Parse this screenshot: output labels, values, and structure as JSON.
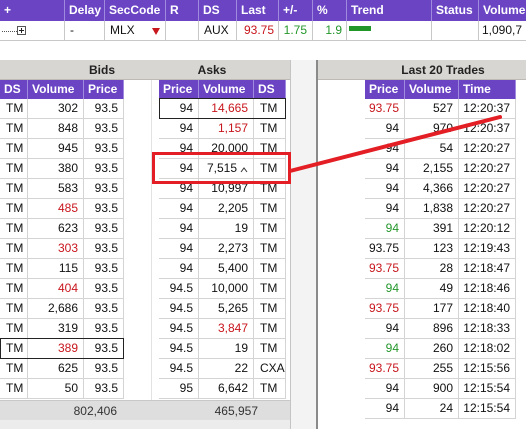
{
  "colors": {
    "header": "#6b44c4",
    "down": "#c8161d",
    "up": "#23962a",
    "annotation": "#e31e24",
    "band": "#d8d6d2"
  },
  "quote_table": {
    "headers": [
      "+",
      "Delay",
      "SecCode",
      "R",
      "DS",
      "Last",
      "+/-",
      "%",
      "Trend",
      "Status",
      "Volume"
    ],
    "row": {
      "expand_icon": "expand-tree-icon",
      "delay": "-",
      "sec_code": "MLX",
      "rating_icon": "down-triangle-icon",
      "ds": "AUX",
      "last": "93.75",
      "change": "1.75",
      "percent": "1.9",
      "trend_icon": "trend-up-bar-icon",
      "volume": "1,090,7"
    }
  },
  "sections": {
    "bids": "Bids",
    "asks": "Asks",
    "trades": "Last 20 Trades"
  },
  "bids": {
    "headers": [
      "DS",
      "Volume",
      "Price"
    ],
    "rows": [
      {
        "ds": "TM",
        "volume": "302",
        "price": "93.5"
      },
      {
        "ds": "TM",
        "volume": "848",
        "price": "93.5"
      },
      {
        "ds": "TM",
        "volume": "945",
        "price": "93.5"
      },
      {
        "ds": "TM",
        "volume": "380",
        "price": "93.5"
      },
      {
        "ds": "TM",
        "volume": "583",
        "price": "93.5"
      },
      {
        "ds": "TM",
        "volume": "485",
        "price": "93.5",
        "volume_color": "down"
      },
      {
        "ds": "TM",
        "volume": "623",
        "price": "93.5"
      },
      {
        "ds": "TM",
        "volume": "303",
        "price": "93.5",
        "volume_color": "down"
      },
      {
        "ds": "TM",
        "volume": "115",
        "price": "93.5"
      },
      {
        "ds": "TM",
        "volume": "404",
        "price": "93.5",
        "volume_color": "down"
      },
      {
        "ds": "TM",
        "volume": "2,686",
        "price": "93.5"
      },
      {
        "ds": "TM",
        "volume": "319",
        "price": "93.5"
      },
      {
        "ds": "TM",
        "volume": "389",
        "price": "93.5",
        "volume_color": "down",
        "selected": true
      },
      {
        "ds": "TM",
        "volume": "625",
        "price": "93.5"
      },
      {
        "ds": "TM",
        "volume": "50",
        "price": "93.5"
      }
    ],
    "total_volume": "802,406"
  },
  "asks": {
    "headers": [
      "Price",
      "Volume",
      "DS"
    ],
    "rows": [
      {
        "price": "94",
        "volume": "14,665",
        "ds": "TM",
        "volume_color": "down",
        "selected": true
      },
      {
        "price": "94",
        "volume": "1,157",
        "ds": "TM",
        "volume_color": "down"
      },
      {
        "price": "94",
        "volume": "20,000",
        "ds": "TM"
      },
      {
        "price": "94",
        "volume": "7,515",
        "ds": "TM",
        "cursor_icon": "mouse-pointer-icon"
      },
      {
        "price": "94",
        "volume": "10,997",
        "ds": "TM"
      },
      {
        "price": "94",
        "volume": "2,205",
        "ds": "TM"
      },
      {
        "price": "94",
        "volume": "19",
        "ds": "TM"
      },
      {
        "price": "94",
        "volume": "2,273",
        "ds": "TM"
      },
      {
        "price": "94",
        "volume": "5,400",
        "ds": "TM"
      },
      {
        "price": "94.5",
        "volume": "10,000",
        "ds": "TM"
      },
      {
        "price": "94.5",
        "volume": "5,265",
        "ds": "TM"
      },
      {
        "price": "94.5",
        "volume": "3,847",
        "ds": "TM",
        "volume_color": "down"
      },
      {
        "price": "94.5",
        "volume": "19",
        "ds": "TM"
      },
      {
        "price": "94.5",
        "volume": "22",
        "ds": "CXA"
      },
      {
        "price": "95",
        "volume": "6,642",
        "ds": "TM"
      }
    ],
    "total_volume": "465,957"
  },
  "trades": {
    "headers": [
      "Price",
      "Volume",
      "Time"
    ],
    "rows": [
      {
        "price": "93.75",
        "volume": "527",
        "time": "12:20:37",
        "price_color": "down"
      },
      {
        "price": "94",
        "volume": "970",
        "time": "12:20:37"
      },
      {
        "price": "94",
        "volume": "54",
        "time": "12:20:27"
      },
      {
        "price": "94",
        "volume": "2,155",
        "time": "12:20:27"
      },
      {
        "price": "94",
        "volume": "4,366",
        "time": "12:20:27"
      },
      {
        "price": "94",
        "volume": "1,838",
        "time": "12:20:27"
      },
      {
        "price": "94",
        "volume": "391",
        "time": "12:20:12",
        "price_color": "up"
      },
      {
        "price": "93.75",
        "volume": "123",
        "time": "12:19:43"
      },
      {
        "price": "93.75",
        "volume": "28",
        "time": "12:18:47",
        "price_color": "down"
      },
      {
        "price": "94",
        "volume": "49",
        "time": "12:18:46",
        "price_color": "up"
      },
      {
        "price": "93.75",
        "volume": "177",
        "time": "12:18:40",
        "price_color": "down"
      },
      {
        "price": "94",
        "volume": "896",
        "time": "12:18:33"
      },
      {
        "price": "94",
        "volume": "260",
        "time": "12:18:02",
        "price_color": "up"
      },
      {
        "price": "93.75",
        "volume": "255",
        "time": "12:15:56",
        "price_color": "down"
      },
      {
        "price": "94",
        "volume": "900",
        "time": "12:15:54"
      },
      {
        "price": "94",
        "volume": "24",
        "time": "12:15:54"
      }
    ]
  }
}
